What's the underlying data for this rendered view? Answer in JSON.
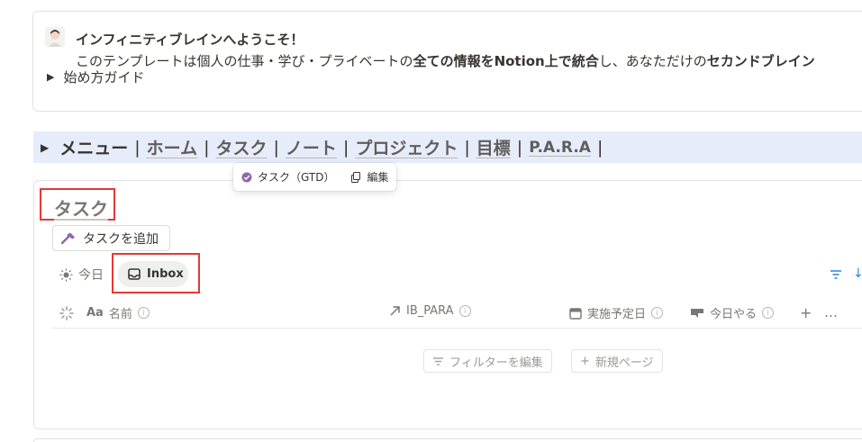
{
  "callout": {
    "title": "インフィニティブレインへようこそ！",
    "body": {
      "part1": "このテンプレートは個人の仕事・学び・プライベートの",
      "bold1": "全ての情報をNotion上で統合",
      "part2": "し、あなただけの",
      "bold2": "セカンドブレイン"
    },
    "guide_label": "始め方ガイド"
  },
  "menu": {
    "title": "メニュー",
    "items": [
      {
        "label": "ホーム"
      },
      {
        "label": "タスク"
      },
      {
        "label": "ノート"
      },
      {
        "label": "プロジェクト"
      },
      {
        "label": "目標"
      },
      {
        "label": "P.A.R.A"
      }
    ]
  },
  "tooltip": {
    "source_label": "タスク（GTD）",
    "edit_label": "編集"
  },
  "database": {
    "title": "タスク",
    "add_button": "タスクを追加",
    "views": [
      {
        "label": "今日",
        "icon": "sun-icon"
      },
      {
        "label": "Inbox",
        "icon": "inbox-icon",
        "active": true
      }
    ],
    "columns": [
      {
        "label": "名前",
        "icon": "Aa"
      },
      {
        "label": "IB_PARA",
        "icon": "relation-arrow-icon"
      },
      {
        "label": "実施予定日",
        "icon": "calendar-icon"
      },
      {
        "label": "今日やる",
        "icon": "rollup-icon"
      }
    ],
    "add_column": "+",
    "more": "…",
    "edit_filter_label": "フィルターを編集",
    "new_page_label": "新規ページ"
  },
  "colors": {
    "accent": "#2383e2",
    "highlight_box": "#e53935",
    "menu_bg": "#e6ecfa",
    "gtd_purple": "#9065b0"
  }
}
